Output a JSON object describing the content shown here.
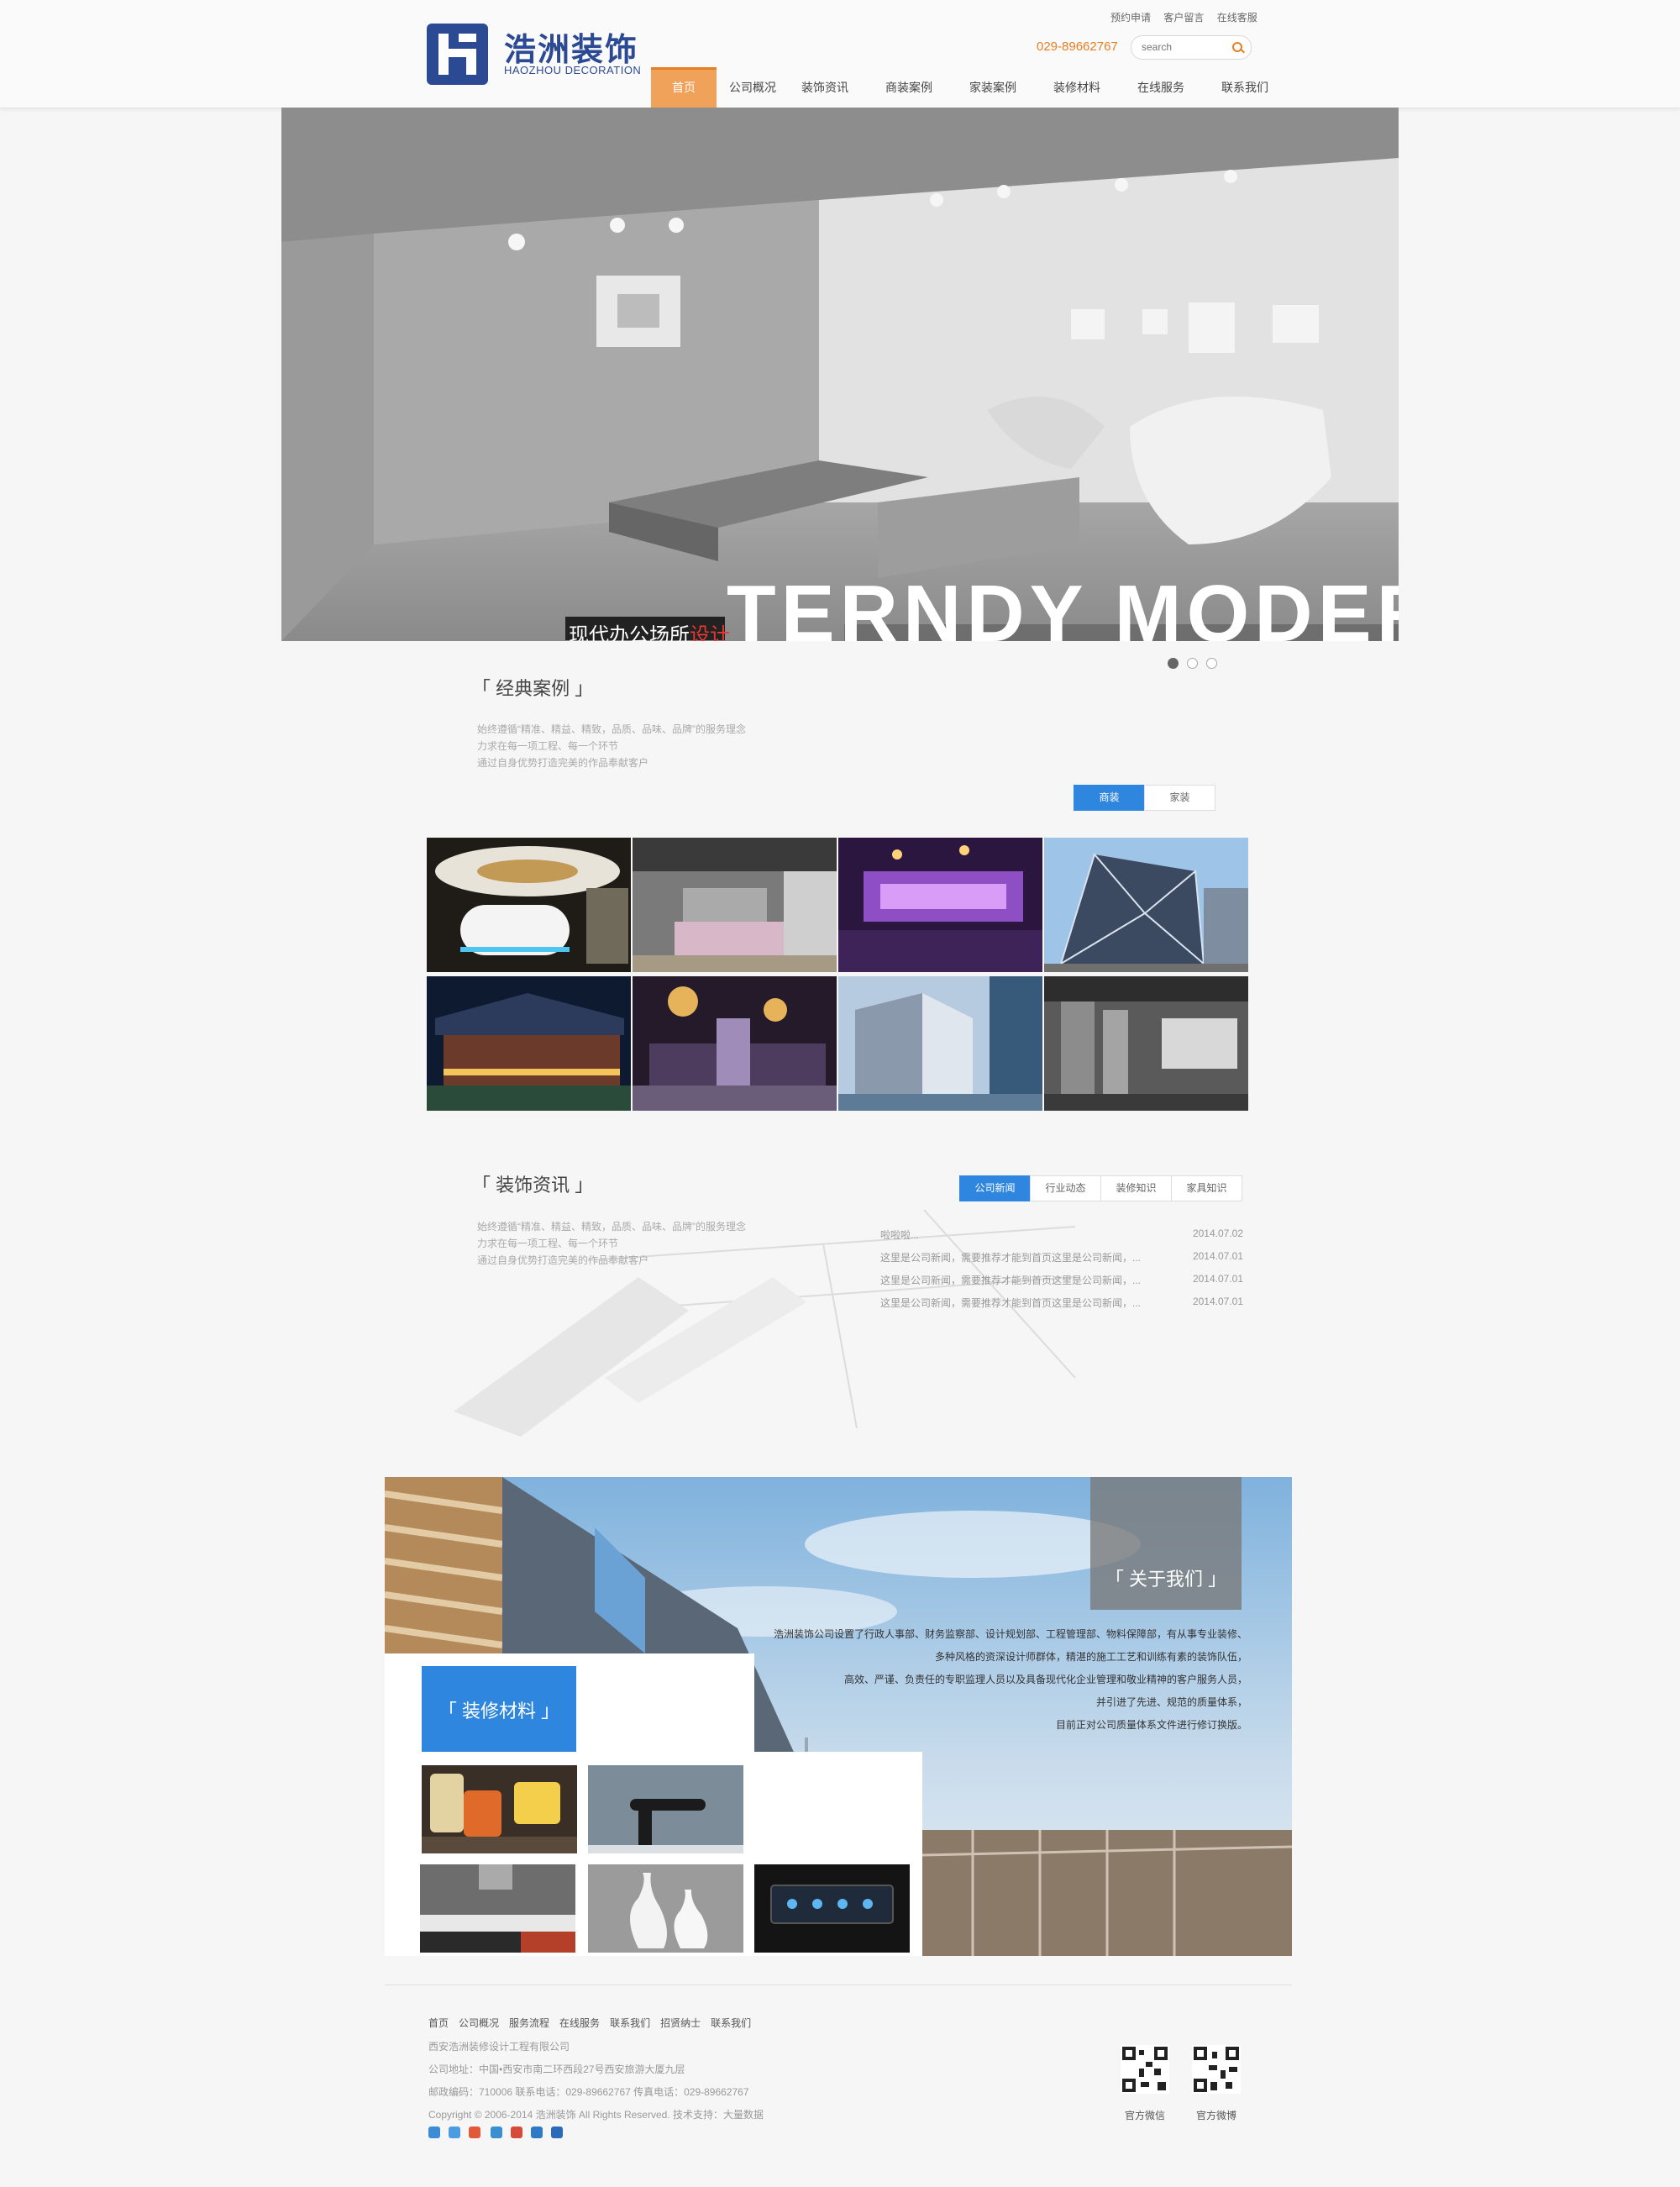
{
  "header": {
    "logo_cn": "浩洲装饰",
    "logo_en": "HAOZHOU DECORATION",
    "top_links": [
      "预约申请",
      "客户留言",
      "在线客服"
    ],
    "phone": "029-89662767",
    "search_placeholder": "search",
    "nav": [
      "首页",
      "公司概况",
      "装饰资讯",
      "商装案例",
      "家装案例",
      "装修材料",
      "在线服务",
      "联系我们"
    ],
    "nav_active": 0
  },
  "banner": {
    "caption_cn_a": "现代办公场所",
    "caption_cn_b": "设计",
    "caption_en": "TERNDY MODERN",
    "slides": 3,
    "active_slide": 0
  },
  "cases": {
    "title": "「 经典案例 」",
    "desc": [
      "始终遵循“精准、精益、精致，品质、品味、品牌”的服务理念",
      "力求在每一项工程、每一个环节",
      "通过自身优势打造完美的作品奉献客户"
    ],
    "tabs": [
      "商装",
      "家装"
    ],
    "active_tab": 0
  },
  "news": {
    "title": "「 装饰资讯 」",
    "desc": [
      "始终遵循“精准、精益、精致，品质、品味、品牌”的服务理念",
      "力求在每一项工程、每一个环节",
      "通过自身优势打造完美的作品奉献客户"
    ],
    "tabs": [
      "公司新闻",
      "行业动态",
      "装修知识",
      "家具知识"
    ],
    "active_tab": 0,
    "items": [
      {
        "title": "啦啦啦...",
        "date": "2014.07.02"
      },
      {
        "title": "这里是公司新闻，需要推荐才能到首页这里是公司新闻，...",
        "date": "2014.07.01"
      },
      {
        "title": "这里是公司新闻，需要推荐才能到首页这里是公司新闻，...",
        "date": "2014.07.01"
      },
      {
        "title": "这里是公司新闻，需要推荐才能到首页这里是公司新闻，...",
        "date": "2014.07.01"
      }
    ]
  },
  "about": {
    "title": "「 关于我们 」",
    "lines": [
      "浩洲装饰公司设置了行政人事部、财务监察部、设计规划部、工程管理部、物料保障部，有从事专业装修、",
      "多种风格的资深设计师群体，精湛的施工工艺和训练有素的装饰队伍，",
      "高效、严谨、负责任的专职监理人员以及具备现代化企业管理和敬业精神的客户服务人员，",
      "并引进了先进、规范的质量体系，",
      "目前正对公司质量体系文件进行修订换版。"
    ]
  },
  "materials": {
    "title": "「 装修材料 」"
  },
  "footer": {
    "links": [
      "首页",
      "公司概况",
      "服务流程",
      "在线服务",
      "联系我们",
      "招贤纳士",
      "联系我们"
    ],
    "company": "西安浩洲装修设计工程有限公司",
    "address": "公司地址：中国•西安市南二环西段27号西安旅游大厦九层",
    "contact": "邮政编码：710006 联系电话：029-89662767 传真电话：029-89662767",
    "copyright": "Copyright © 2006-2014 浩洲装饰 All Rights Reserved. 技术支持：大量数据",
    "qr_labels": [
      "官方微信",
      "官方微博"
    ]
  },
  "colors": {
    "brand": "#2c4a93",
    "accent_orange": "#e67e22",
    "nav_active_bg": "#f0a15a",
    "tab_active": "#2e86de"
  }
}
